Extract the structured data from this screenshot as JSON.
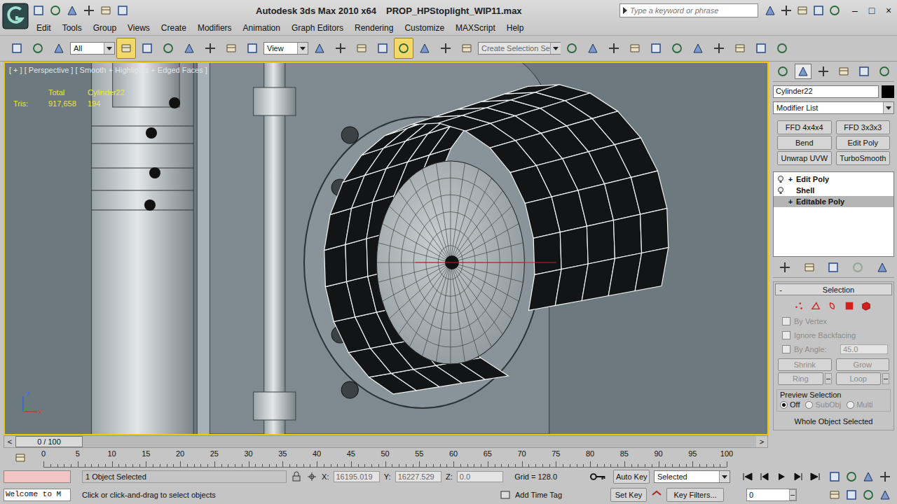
{
  "window": {
    "title": "Autodesk 3ds Max 2010 x64",
    "file": "PROP_HPStoplight_WIP11.max",
    "controls": [
      "–",
      "□",
      "×"
    ]
  },
  "quick_access": [
    {
      "disabled": false
    },
    {
      "disabled": false
    },
    {
      "disabled": false
    },
    {
      "disabled": false
    },
    {
      "disabled": false
    },
    {
      "disabled": false
    }
  ],
  "search": {
    "placeholder": "Type a keyword or phrase"
  },
  "help_icons": [
    {
      "disabled": false
    },
    {
      "disabled": false
    },
    {
      "disabled": false
    },
    {
      "disabled": false
    },
    {
      "disabled": false
    }
  ],
  "menu": [
    "Edit",
    "Tools",
    "Group",
    "Views",
    "Create",
    "Modifiers",
    "Animation",
    "Graph Editors",
    "Rendering",
    "Customize",
    "MAXScript",
    "Help"
  ],
  "toolbar": {
    "items": [
      {
        "kind": "button",
        "active": false
      },
      {
        "kind": "button",
        "active": false
      },
      {
        "kind": "button",
        "active": false
      },
      {
        "kind": "dropdown",
        "value": "All"
      },
      {
        "kind": "button",
        "active": true
      },
      {
        "kind": "button",
        "active": false
      },
      {
        "kind": "button",
        "active": false
      },
      {
        "kind": "button",
        "active": false
      },
      {
        "kind": "button",
        "active": false
      },
      {
        "kind": "button",
        "active": false
      },
      {
        "kind": "button",
        "active": false
      },
      {
        "kind": "dropdown",
        "value": "View"
      },
      {
        "kind": "button",
        "active": false
      },
      {
        "kind": "button",
        "active": false
      },
      {
        "kind": "button",
        "active": false
      },
      {
        "kind": "button",
        "active": false
      },
      {
        "kind": "button",
        "active": true
      },
      {
        "kind": "button",
        "active": false
      },
      {
        "kind": "button",
        "active": false
      },
      {
        "kind": "button",
        "active": false
      },
      {
        "kind": "field",
        "value": "Create Selection Se"
      },
      {
        "kind": "button",
        "active": false
      },
      {
        "kind": "button",
        "active": false
      },
      {
        "kind": "button",
        "active": false
      },
      {
        "kind": "button",
        "active": false
      },
      {
        "kind": "button",
        "active": false
      },
      {
        "kind": "button",
        "active": false
      },
      {
        "kind": "button",
        "active": false
      },
      {
        "kind": "button",
        "active": false
      },
      {
        "kind": "button",
        "active": false
      },
      {
        "kind": "button",
        "active": false
      },
      {
        "kind": "button",
        "active": false
      }
    ]
  },
  "viewport": {
    "label": "[ + ] [ Perspective ] [ Smooth + Highlights + Edged Faces ]",
    "active": true,
    "stats": {
      "header": [
        "Total",
        "Cylinder22"
      ],
      "rows": [
        {
          "label": "Tris:",
          "values": [
            "917,658",
            "194"
          ]
        }
      ]
    },
    "axis": [
      "z",
      "x"
    ]
  },
  "command_panel": {
    "tabs": [
      {
        "selected": false
      },
      {
        "selected": true
      },
      {
        "selected": false
      },
      {
        "selected": false
      },
      {
        "selected": false
      },
      {
        "selected": false
      }
    ],
    "object_name": "Cylinder22",
    "modifier_list": "Modifier List",
    "modifier_buttons": [
      "FFD 4x4x4",
      "FFD 3x3x3",
      "Bend",
      "Edit Poly",
      "Unwrap UVW",
      "TurboSmooth"
    ],
    "stack": [
      {
        "label": "Edit Poly",
        "expand": "+",
        "kind": "modifier",
        "selected": false
      },
      {
        "label": "Shell",
        "expand": "",
        "kind": "modifier",
        "selected": false
      },
      {
        "label": "Editable Poly",
        "expand": "+",
        "kind": "base",
        "selected": true
      }
    ],
    "stack_tools": [
      {
        "disabled": false
      },
      {
        "disabled": false
      },
      {
        "disabled": false
      },
      {
        "disabled": true
      },
      {
        "disabled": false
      }
    ],
    "selection": {
      "toggle": "-",
      "title": "Selection",
      "subobjects": [
        {
          "selected": false
        },
        {
          "selected": false
        },
        {
          "selected": false
        },
        {
          "selected": false
        },
        {
          "selected": false
        }
      ],
      "checks": [
        {
          "kind": "check",
          "label": "By Vertex",
          "checked": false,
          "disabled": true
        },
        {
          "kind": "check",
          "label": "Ignore Backfacing",
          "checked": false,
          "disabled": true
        },
        {
          "kind": "check-spinner",
          "label": "By Angle:",
          "value": "45.0",
          "checked": false,
          "disabled": true
        }
      ],
      "buttons": [
        {
          "kind": "button",
          "label": "Shrink",
          "disabled": true
        },
        {
          "kind": "button",
          "label": "Grow",
          "disabled": true
        },
        {
          "kind": "button-spinner",
          "label": "Ring",
          "disabled": true
        },
        {
          "kind": "button-spinner",
          "label": "Loop",
          "disabled": true
        }
      ],
      "preview": {
        "title": "Preview Selection",
        "options": [
          {
            "label": "Off",
            "selected": true,
            "disabled": false
          },
          {
            "label": "SubObj",
            "selected": false,
            "disabled": true
          },
          {
            "label": "Multi",
            "selected": false,
            "disabled": true
          }
        ]
      },
      "status": "Whole Object Selected"
    }
  },
  "time_slider": {
    "prev": "<",
    "next": ">",
    "thumb": "0 / 100",
    "level": 0
  },
  "trackbar": {
    "ticks": [
      "0",
      "5",
      "10",
      "15",
      "20",
      "25",
      "30",
      "35",
      "40",
      "45",
      "50",
      "55",
      "60",
      "65",
      "70",
      "75",
      "80",
      "85",
      "90",
      "95",
      "100"
    ]
  },
  "status_bar": {
    "prompt": "Welcome to M",
    "selection": "1 Object Selected",
    "coords": [
      {
        "label": "X:",
        "value": "16195.019"
      },
      {
        "label": "Y:",
        "value": "16227.529"
      },
      {
        "label": "Z:",
        "value": "0.0"
      }
    ],
    "grid": "Grid = 128.0",
    "auto_key": {
      "label": "Auto Key",
      "on": false
    },
    "key_mode": "Selected",
    "set_key": "Set Key",
    "key_filters": "Key Filters...",
    "hint": "Click or click-and-drag to select objects",
    "time_tag": "Add Time Tag",
    "frame": "0"
  }
}
